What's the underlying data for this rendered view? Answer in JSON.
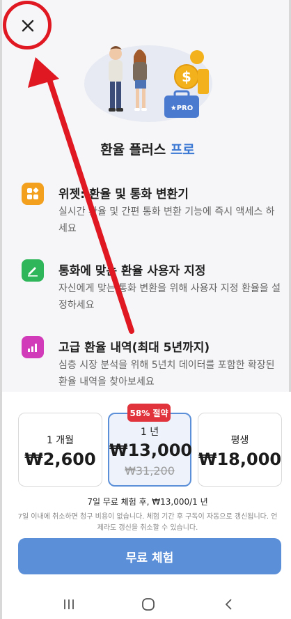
{
  "header": {
    "close_icon": "close-icon"
  },
  "title": {
    "main": "환율 플러스",
    "pro": "프로"
  },
  "features": [
    {
      "icon": "widget-icon",
      "color": "#f2a01e",
      "title": "위젯: 환율 및 통화 변환기",
      "desc": "실시간 환율 및 간편 통화 변환 기능에 즉시 액세스 하세요"
    },
    {
      "icon": "edit-icon",
      "color": "#2fb65a",
      "title": "통화에 맞는 환율 사용자 지정",
      "desc": "자신에게 맞는 통화 변환을 위해 사용자 지정 환율을 설정하세요"
    },
    {
      "icon": "chart-icon",
      "color": "#d13ab8",
      "title": "고급 환율 내역(최대 5년까지)",
      "desc": "심층 시장 분석을 위해 5년치 데이터를 포함한 확장된 환율 내역을 찾아보세요"
    }
  ],
  "plans": [
    {
      "name": "1 개월",
      "price": "₩2,600"
    },
    {
      "name": "1 년",
      "price": "₩13,000",
      "old_price": "₩31,200",
      "badge": "58% 절약"
    },
    {
      "name": "평생",
      "price": "₩18,000"
    }
  ],
  "trial": {
    "line": "7일 무료 체험 후, ₩13,000/1 년",
    "fine": "7일 이내에 취소하면 청구 비용이 없습니다. 체험 기간 후 구독이 자동으로 갱신됩니다. 언제라도 갱신을 취소할 수 있습니다.",
    "cta": "무료 체험"
  },
  "colors": {
    "accent": "#5b8fd8",
    "pro_text": "#3a78d4",
    "badge": "#e0333b",
    "annotation": "#e01822"
  }
}
